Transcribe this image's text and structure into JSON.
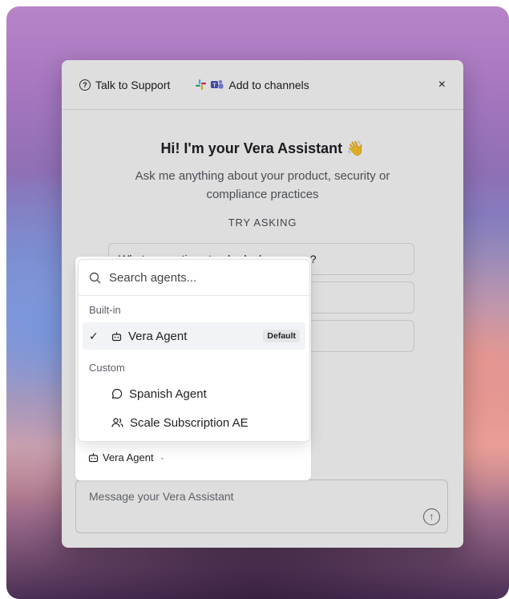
{
  "header": {
    "support_label": "Talk to Support",
    "channels_label": "Add to channels",
    "close_glyph": "×"
  },
  "hero": {
    "title": "Hi! I'm your Vera Assistant 👋",
    "subtitle": "Ask me anything about your product, security or compliance practices",
    "try_label": "TRY ASKING"
  },
  "suggestions": [
    "What encryption standards do you use?",
    "",
    ""
  ],
  "agent_picker": {
    "search_placeholder": "Search agents...",
    "groups": {
      "builtin_label": "Built-in",
      "custom_label": "Custom"
    },
    "items": [
      {
        "label": "Vera Agent",
        "badge": "Default",
        "selected": true,
        "icon": "robot-icon"
      },
      {
        "label": "Spanish Agent",
        "icon": "message-bubble-icon"
      },
      {
        "label": "Scale Subscription AE",
        "icon": "users-icon"
      }
    ],
    "current_label": "Vera Agent"
  },
  "composer": {
    "placeholder": "Message your Vera Assistant"
  },
  "colors": {
    "accent_bg": "#f1f3f6",
    "badge_bg": "#e4e6ea"
  }
}
